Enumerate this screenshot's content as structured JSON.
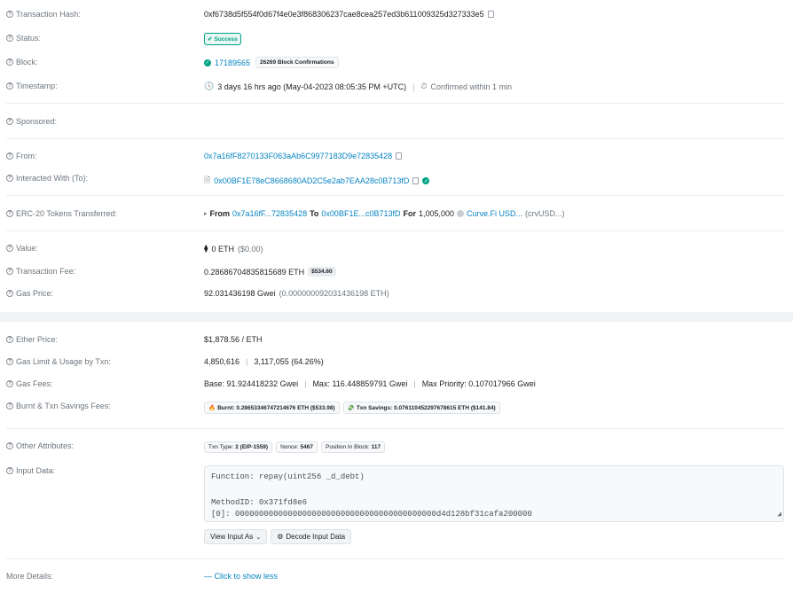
{
  "tx_hash": {
    "label": "Transaction Hash:",
    "value": "0xf6738d5f554f0d67f4e0e3f868306237cae8cea257ed3b611009325d327333e5"
  },
  "status": {
    "label": "Status:",
    "value": "Success"
  },
  "block": {
    "label": "Block:",
    "number": "17189565",
    "confirmations": "26269 Block Confirmations"
  },
  "timestamp": {
    "label": "Timestamp:",
    "value": "3 days 16 hrs ago (May-04-2023 08:05:35 PM +UTC)",
    "confirmed": "Confirmed within 1 min"
  },
  "sponsored": {
    "label": "Sponsored:"
  },
  "from": {
    "label": "From:",
    "value": "0x7a16fF8270133F063aAb6C9977183D9e72835428"
  },
  "to": {
    "label": "Interacted With (To):",
    "value": "0x00BF1E78eC8668680AD2C5e2ab7EAA28c0B713fD"
  },
  "erc20": {
    "label": "ERC-20 Tokens Transferred:",
    "from_word": "From",
    "from_addr": "0x7a16fF...72835428",
    "to_word": "To",
    "to_addr": "0x00BF1E...c0B713fD",
    "for_word": "For",
    "amount": "1,005,000",
    "token": "Curve.Fi USD...",
    "symbol": "(crvUSD...)"
  },
  "value": {
    "label": "Value:",
    "eth": "0 ETH",
    "usd": "($0.00)"
  },
  "fee": {
    "label": "Transaction Fee:",
    "eth": "0.28686704835815689 ETH",
    "usd": "$534.60"
  },
  "gas_price": {
    "label": "Gas Price:",
    "gwei": "92.031436198 Gwei",
    "eth": "(0.000000092031436198 ETH)"
  },
  "ether_price": {
    "label": "Ether Price:",
    "value": "$1,878.56 / ETH"
  },
  "gas_limit": {
    "label": "Gas Limit & Usage by Txn:",
    "limit": "4,850,616",
    "usage": "3,117,055 (64.26%)"
  },
  "gas_fees": {
    "label": "Gas Fees:",
    "base": "Base: 91.924418232 Gwei",
    "max": "Max: 116.448859791 Gwei",
    "max_priority": "Max Priority: 0.107017966 Gwei"
  },
  "burnt": {
    "label": "Burnt & Txn Savings Fees:",
    "burnt": "Burnt: 0.28653346747214676 ETH ($533.98)",
    "savings": "Txn Savings: 0.076110452297678615 ETH ($141.84)"
  },
  "other": {
    "label": "Other Attributes:",
    "txn_type_label": "Txn Type:",
    "txn_type": "2 (EIP-1559)",
    "nonce_label": "Nonce:",
    "nonce": "5467",
    "position_label": "Position In Block:",
    "position": "117"
  },
  "input": {
    "label": "Input Data:",
    "line1": "Function: repay(uint256 _d_debt)",
    "line2": "",
    "line3": "MethodID: 0x371fd8e6",
    "line4": "[0]:  000000000000000000000000000000000000000000d4d128bf31cafa200000",
    "view_btn": "View Input As",
    "decode_btn": "Decode Input Data"
  },
  "more": {
    "label": "More Details:",
    "link": "— Click to show less"
  },
  "colors": {
    "link": "#0784c3",
    "success": "#00a186"
  }
}
